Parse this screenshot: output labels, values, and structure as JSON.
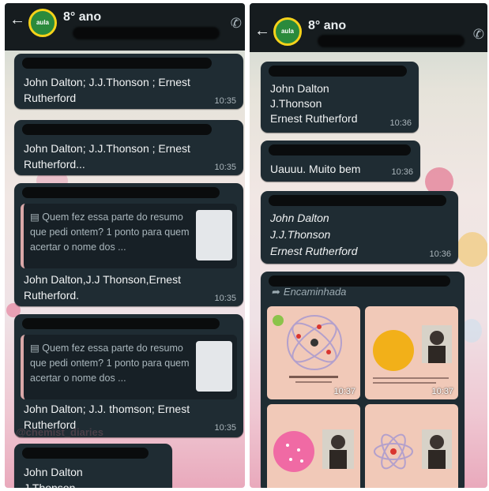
{
  "chat": {
    "title": "8° ano",
    "avatar_text": "aula",
    "forwarded_label": "Encaminhada"
  },
  "left_panel": {
    "messages": [
      {
        "text1": "John Dalton; J.J.Thonson ; Ernest",
        "text2": "Rutherford",
        "time": "10:35"
      },
      {
        "text1": "John Dalton; J.J.Thonson ; Ernest",
        "text2": "Rutherford...",
        "time": "10:35"
      },
      {
        "quote": "Quem fez essa parte do resumo que pedi ontem? 1 ponto para quem acertar o nome dos ...",
        "text1": "John Dalton,J.J Thonson,Ernest",
        "text2": "Rutherford.",
        "time": "10:35"
      },
      {
        "quote": "Quem fez essa parte do resumo que pedi ontem? 1 ponto para quem acertar o nome dos ...",
        "text1": "John Dalton; J.J. thomson; Ernest",
        "text2": "Rutherford",
        "time": "10:35"
      },
      {
        "text1": "John Dalton",
        "text2": "J.Thonson"
      }
    ],
    "watermark": "@chemist_diaries"
  },
  "right_panel": {
    "messages": [
      {
        "text1": "John Dalton",
        "text2": "J.Thonson",
        "text3": "Ernest Rutherford",
        "time": "10:36"
      },
      {
        "text1": "Uauuu. Muito bem",
        "time": "10:36"
      },
      {
        "text1": "John Dalton",
        "text2": "J.J.Thonson",
        "text3": "Ernest Rutherford",
        "time": "10:36"
      }
    ],
    "media_times": [
      "10:37",
      "10:37"
    ]
  },
  "colors": {
    "header": "#161c1f",
    "bubble": "#1f2c33",
    "quote_bar": "#d9a8a8"
  }
}
